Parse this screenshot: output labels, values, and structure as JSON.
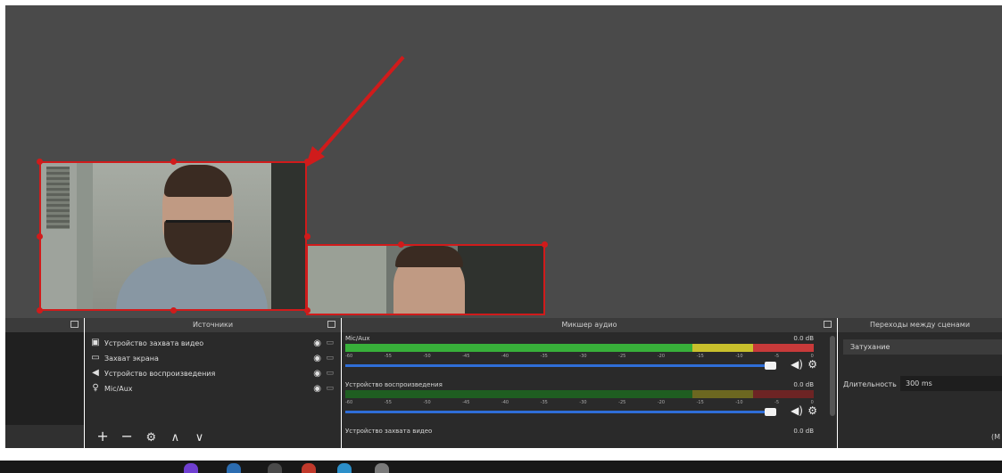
{
  "colors": {
    "selection": "#d01b1b",
    "meter_green": "#38b03a",
    "meter_yellow": "#c9c02c",
    "meter_red": "#c83a3a",
    "volume_blue": "#2f6ed8"
  },
  "sources": {
    "title": "Источники",
    "items": [
      {
        "label": "Устройство захвата видео",
        "icon": "camera-icon"
      },
      {
        "label": "Захват экрана",
        "icon": "monitor-icon"
      },
      {
        "label": "Устройство воспроизведения",
        "icon": "speaker-icon"
      },
      {
        "label": "Mic/Aux",
        "icon": "microphone-icon"
      }
    ],
    "toolbar": {
      "add": "+",
      "remove": "−",
      "settings": "⚙",
      "up": "∧",
      "down": "∨"
    }
  },
  "mixer": {
    "title": "Микшер аудио",
    "channels": [
      {
        "name": "Mic/Aux",
        "db": "0.0 dB",
        "level": 0.86
      },
      {
        "name": "Устройство воспроизведения",
        "db": "0.0 dB",
        "level": 0.0
      },
      {
        "name": "Устройство захвата видео",
        "db": "0.0 dB"
      }
    ],
    "ticks": [
      "-60",
      "-55",
      "-50",
      "-45",
      "-40",
      "-35",
      "-30",
      "-25",
      "-20",
      "-15",
      "-10",
      "-5",
      "0"
    ]
  },
  "transitions": {
    "title": "Переходы между сценами",
    "selected": "Затухание",
    "duration_label": "Длительность",
    "duration_value": "300 ms"
  },
  "statusbar": {
    "text": "(M"
  }
}
